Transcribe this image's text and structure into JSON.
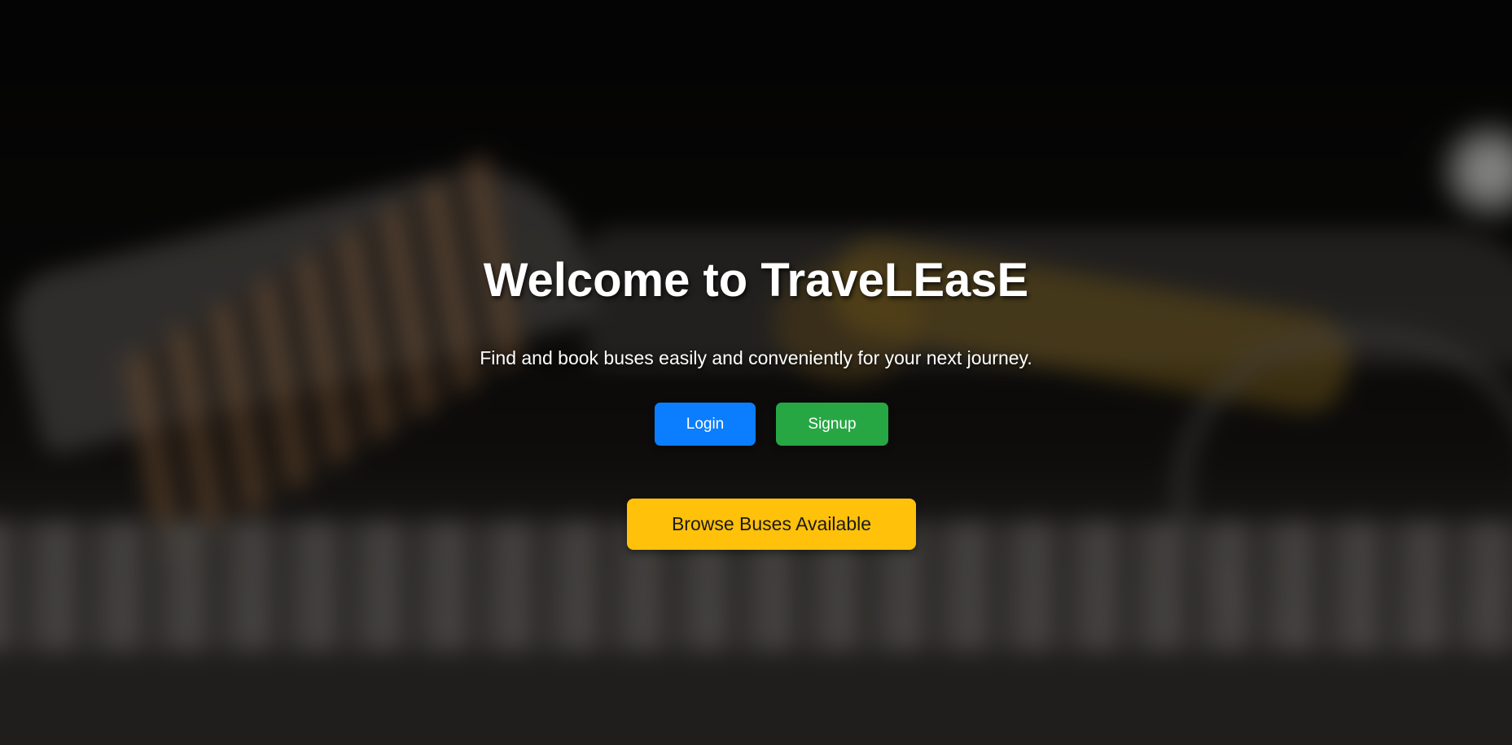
{
  "hero": {
    "title": "Welcome to TraveLEasE",
    "subtitle": "Find and book buses easily and conveniently for your next journey.",
    "login_label": "Login",
    "signup_label": "Signup",
    "browse_label": "Browse Buses Available"
  },
  "colors": {
    "login": "#0b7dff",
    "signup": "#27a744",
    "browse": "#ffc10a",
    "text": "#ffffff"
  }
}
